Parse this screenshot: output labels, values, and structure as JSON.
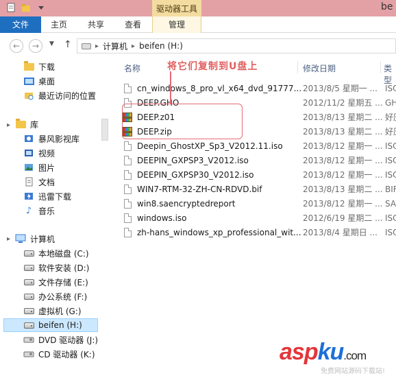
{
  "title_bar": {
    "context_tool_label": "驱动器工具",
    "window_title_fragment": "be"
  },
  "ribbon": {
    "tabs": [
      {
        "label": "文件"
      },
      {
        "label": "主页"
      },
      {
        "label": "共享"
      },
      {
        "label": "查看"
      },
      {
        "label": "管理"
      }
    ]
  },
  "address_bar": {
    "path_computer": "计算机",
    "path_drive": "beifen (H:)",
    "separator": "▸"
  },
  "nav_pane": {
    "favorites": [
      {
        "label": "下载",
        "icon": "download-folder-icon"
      },
      {
        "label": "桌面",
        "icon": "desktop-icon"
      },
      {
        "label": "最近访问的位置",
        "icon": "recent-places-icon"
      }
    ],
    "libraries_label": "库",
    "libraries": [
      {
        "label": "暴风影视库",
        "icon": "media-library-icon"
      },
      {
        "label": "视频",
        "icon": "video-icon"
      },
      {
        "label": "图片",
        "icon": "picture-icon"
      },
      {
        "label": "文档",
        "icon": "document-icon"
      },
      {
        "label": "迅雷下载",
        "icon": "thunder-download-icon"
      },
      {
        "label": "音乐",
        "icon": "music-icon"
      }
    ],
    "computer_label": "计算机",
    "drives": [
      {
        "label": "本地磁盘 (C:)"
      },
      {
        "label": "软件安装 (D:)"
      },
      {
        "label": "文件存储 (E:)"
      },
      {
        "label": "办公系统 (F:)"
      },
      {
        "label": "虚拟机 (G:)"
      },
      {
        "label": "beifen (H:)",
        "selected": true
      },
      {
        "label": "DVD 驱动器 (J:)"
      },
      {
        "label": "CD 驱动器 (K:)"
      }
    ]
  },
  "file_list": {
    "columns": {
      "name": "名称",
      "date": "修改日期",
      "type": "类型"
    },
    "files": [
      {
        "name": "cn_windows_8_pro_vl_x64_dvd_91777...",
        "date": "2013/8/5 星期一 ...",
        "type": "ISO",
        "icon": "doc"
      },
      {
        "name": "DEEP.GHO",
        "date": "2012/11/2 星期五 ...",
        "type": "GHO",
        "icon": "doc"
      },
      {
        "name": "DEEP.z01",
        "date": "2013/8/13 星期二 ...",
        "type": "好压",
        "icon": "rar"
      },
      {
        "name": "DEEP.zip",
        "date": "2013/8/13 星期二 ...",
        "type": "好压",
        "icon": "rar"
      },
      {
        "name": "Deepin_GhostXP_Sp3_V2012.11.iso",
        "date": "2013/8/12 星期一 ...",
        "type": "ISO",
        "icon": "doc"
      },
      {
        "name": "DEEPIN_GXPSP3_V2012.iso",
        "date": "2013/8/12 星期一 ...",
        "type": "ISO",
        "icon": "doc"
      },
      {
        "name": "DEEPIN_GXPSP30_V2012.iso",
        "date": "2013/8/12 星期一 ...",
        "type": "ISO",
        "icon": "doc"
      },
      {
        "name": "WIN7-RTM-32-ZH-CN-RDVD.bif",
        "date": "2013/8/13 星期二 ...",
        "type": "BIF",
        "icon": "doc"
      },
      {
        "name": "win8.saencryptedreport",
        "date": "2013/8/12 星期一 ...",
        "type": "SA",
        "icon": "doc"
      },
      {
        "name": "windows.iso",
        "date": "2012/6/19 星期二 ...",
        "type": "ISO",
        "icon": "doc"
      },
      {
        "name": "zh-hans_windows_xp_professional_wit...",
        "date": "2013/8/4 星期日 ...",
        "type": "ISO",
        "icon": "doc"
      }
    ]
  },
  "annotation": {
    "text": "将它们复制到U盘上",
    "color": "#e06060"
  },
  "watermark": {
    "brand_a": "asp",
    "brand_b": "ku",
    "brand_c": ".com",
    "subtitle": "免费网站源码下载站!"
  },
  "colors": {
    "file_tab": "#1f6fc1",
    "title_bar": "#e3a0a5",
    "context_tab": "#f3dca0",
    "selection": "#cce8ff"
  }
}
